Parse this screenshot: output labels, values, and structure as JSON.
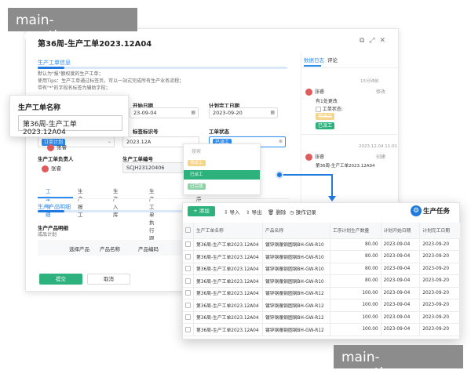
{
  "watermark": "main-venetian.com",
  "window": {
    "title": "第36周-生产工单2023.12A04",
    "section_info": "生产工单信息",
    "tips": [
      "默认为\"报\"额权度的生产工单；",
      "使用Tips：生产工单通过标签页，可以一站式完成所有生产业务流程；",
      "带有\"*\"的字段名标签为辅助字段；"
    ],
    "fields": {
      "plan_start_label": "开始日期",
      "plan_start_value": "23-09-04",
      "plan_end_label": "计划完工日期",
      "plan_end_value": "2023-09-20",
      "type_tag": "订单计划",
      "batch_label": "标签标识号",
      "batch_value": "2023.12A",
      "status_label": "工单状态",
      "status_value": "已派工",
      "owner_label": "生产工单负责人",
      "owner_value": "张睿",
      "code_label": "生产工单编号",
      "code_value": "SCJH23120406",
      "avatar_name": "张睿"
    },
    "tabs": [
      "工单明细",
      "生产报工",
      "生产入库",
      "生产工单执行跟踪",
      "工序报"
    ],
    "detail_section": "生产产品明细",
    "detail_sub_title": "生产产品明细",
    "detail_sub": "成品计划",
    "detail_headers": [
      "选择产品",
      "产品名称",
      "产品编码"
    ],
    "submit": "提交",
    "cancel": "取消"
  },
  "side": {
    "tab_log": "数据日志",
    "tab_comment": "评论",
    "entry1_time": "15分钟前",
    "entry1_user": "张睿",
    "entry1_action": "修改",
    "entry1_line1": "有1处更改",
    "entry1_line2": "工单状态:",
    "entry1_old": "待派工",
    "entry1_new": "已派工",
    "entry2_time": "2023.12.04 11:01",
    "entry2_user": "张睿",
    "entry2_action": "创建",
    "entry2_detail": "第36周-生产工单2023.12A04"
  },
  "dropdown": {
    "search": "搜索",
    "options": [
      {
        "label": "待派工",
        "bg": "#f5d58a",
        "fg": "#fff"
      },
      {
        "label": "已派工",
        "bg": "#2db27d",
        "fg": "#fff"
      },
      {
        "label": "已完成",
        "bg": "#8dd3a8",
        "fg": "#fff"
      }
    ]
  },
  "callout": {
    "title": "生产工单名称",
    "value": "第36周-生产工单2023.12A04"
  },
  "panel": {
    "title": "生产任务",
    "add": "+ 添加",
    "import": "导入",
    "export": "导出",
    "delete": "删除",
    "log": "操作记录",
    "headers": [
      "生产工单名称",
      "产品名称",
      "工序计划生产数量",
      "计划开始日期",
      "计划完工日期"
    ],
    "rows": [
      [
        "第36周-生产工单2023.12A04",
        "镀锌钢覆钢圆钢BH-GW-R10",
        "80.00",
        "2023-09-04",
        "2023-09-20"
      ],
      [
        "第36周-生产工单2023.12A04",
        "镀锌钢覆钢圆钢BH-GW-R10",
        "80.00",
        "2023-09-04",
        "2023-09-20"
      ],
      [
        "第36周-生产工单2023.12A04",
        "镀锌钢覆钢圆钢BH-GW-R10",
        "80.00",
        "2023-09-04",
        "2023-09-20"
      ],
      [
        "第36周-生产工单2023.12A04",
        "镀锌钢覆钢圆钢BH-GW-R10",
        "80.00",
        "2023-09-04",
        "2023-09-20"
      ],
      [
        "第36周-生产工单2023.12A04",
        "镀锌钢覆钢圆钢BH-GW-R12",
        "100.00",
        "2023-09-04",
        "2023-09-20"
      ],
      [
        "第36周-生产工单2023.12A04",
        "镀锌钢覆钢圆钢BH-GW-R12",
        "100.00",
        "2023-09-04",
        "2023-09-20"
      ],
      [
        "第36周-生产工单2023.12A04",
        "镀锌钢覆钢圆钢BH-GW-R12",
        "100.00",
        "2023-09-04",
        "2023-09-20"
      ],
      [
        "第36周-生产工单2023.12A04",
        "镀锌钢覆钢圆钢BH-GW-R12",
        "100.00",
        "2023-09-04",
        "2023-09-20"
      ]
    ]
  }
}
